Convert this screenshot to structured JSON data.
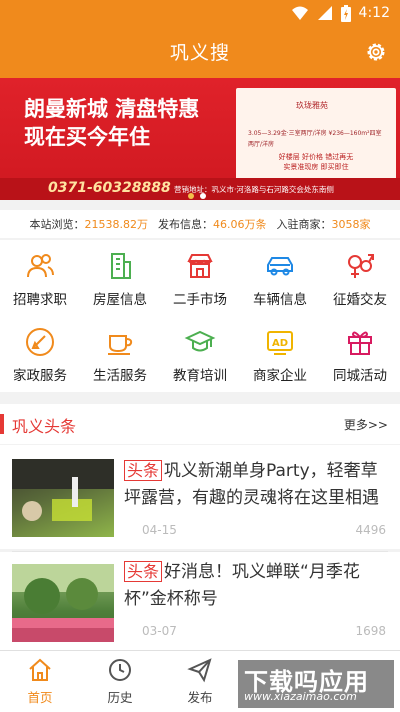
{
  "status_bar": {
    "time": "4:12"
  },
  "header": {
    "title": "巩义搜"
  },
  "banner": {
    "headline_line1": "朗曼新城 清盘特惠",
    "headline_line2": "现在买今年住",
    "brand": "玖珑雅苑",
    "dates_line": "3.05—3.29金·三室两厅/洋房   ¥236—160m²四室两厅/洋房",
    "perks_line1": "好楼层 好价格 错过再无",
    "perks_line2": "实景准现房 即买即住",
    "phone": "0371-60328888",
    "address": "营销地址：巩义市·河洛路与石河路交会处东南侧"
  },
  "stats": {
    "views_label": "本站浏览：",
    "views_value": "21538.82万",
    "posts_label": "发布信息：",
    "posts_value": "46.06万条",
    "merchants_label": "入驻商家：",
    "merchants_value": "3058家"
  },
  "categories": [
    {
      "label": "招聘求职",
      "icon": "people-icon",
      "color": "#f08a1c"
    },
    {
      "label": "房屋信息",
      "icon": "building-icon",
      "color": "#4caf50"
    },
    {
      "label": "二手市场",
      "icon": "shop-icon",
      "color": "#e53935"
    },
    {
      "label": "车辆信息",
      "icon": "car-icon",
      "color": "#1e88e5"
    },
    {
      "label": "征婚交友",
      "icon": "gender-icon",
      "color": "#e53935"
    },
    {
      "label": "家政服务",
      "icon": "cleaning-icon",
      "color": "#f08a1c"
    },
    {
      "label": "生活服务",
      "icon": "coffee-cup-icon",
      "color": "#f08a1c"
    },
    {
      "label": "教育培训",
      "icon": "graduation-cap-icon",
      "color": "#4caf50"
    },
    {
      "label": "商家企业",
      "icon": "ad-icon",
      "color": "#f0b400"
    },
    {
      "label": "同城活动",
      "icon": "gift-icon",
      "color": "#d81b60"
    }
  ],
  "news": {
    "section_title": "巩义头条",
    "more_label": "更多>>",
    "items": [
      {
        "tag": "头条",
        "title": "巩义新潮单身Party，轻奢草坪露营，有趣的灵魂将在这里相遇",
        "date": "04-15",
        "views": "4496"
      },
      {
        "tag": "头条",
        "title": "好消息！巩义蝉联“月季花杯”金杯称号",
        "date": "03-07",
        "views": "1698"
      }
    ]
  },
  "bottom_nav": [
    {
      "label": "首页",
      "icon": "home-icon"
    },
    {
      "label": "历史",
      "icon": "clock-icon"
    },
    {
      "label": "发布",
      "icon": "send-icon"
    }
  ],
  "watermark": {
    "big": "下载吗应用",
    "small": "www.xiazaimao.com"
  },
  "colors": {
    "primary": "#f08a1c",
    "accent_red": "#e53935"
  }
}
